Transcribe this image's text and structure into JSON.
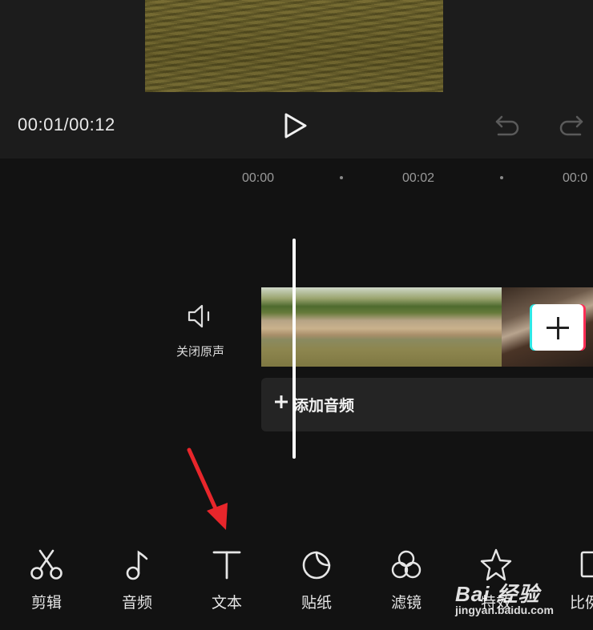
{
  "preview": {
    "time_current": "00:01",
    "time_total": "00:12",
    "time_text": "00:01/00:12"
  },
  "ruler": {
    "ticks": [
      "00:00",
      "00:02",
      "00:0"
    ]
  },
  "track": {
    "mute_label": "关闭原声",
    "add_audio_label": "添加音频"
  },
  "toolbar": {
    "items": [
      {
        "label": "剪辑",
        "icon": "scissors-icon"
      },
      {
        "label": "音频",
        "icon": "music-note-icon"
      },
      {
        "label": "文本",
        "icon": "text-icon"
      },
      {
        "label": "贴纸",
        "icon": "sticker-icon"
      },
      {
        "label": "滤镜",
        "icon": "filter-icon"
      },
      {
        "label": "特效",
        "icon": "effects-star-icon"
      },
      {
        "label": "比例",
        "icon": "ratio-icon"
      }
    ]
  },
  "annotation": {
    "arrow_color": "#e8262b",
    "arrow_target": "文本"
  },
  "watermark": {
    "brand": "Bai 经验",
    "url": "jingyan.baidu.com"
  },
  "colors": {
    "background": "#121212",
    "preview_bg": "#1c1c1c",
    "accent_cyan": "#2ee8e6",
    "accent_red": "#ff2d55"
  }
}
